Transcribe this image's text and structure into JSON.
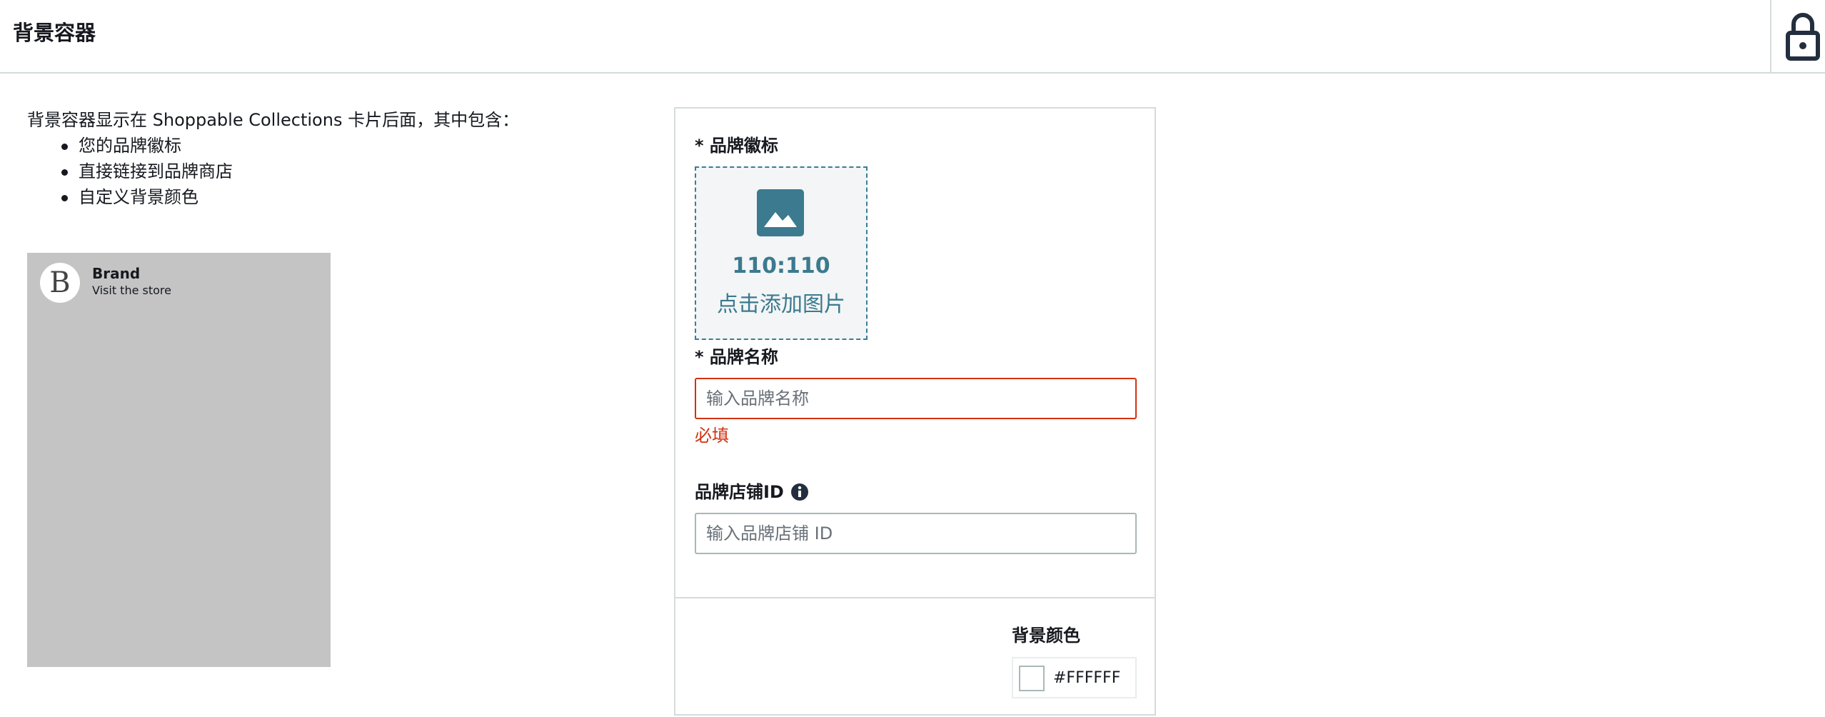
{
  "header": {
    "title": "背景容器",
    "lock_icon": "lock-icon"
  },
  "description": {
    "intro": "背景容器显示在 Shoppable Collections 卡片后面，其中包含：",
    "items": [
      "您的品牌徽标",
      "直接链接到品牌商店",
      "自定义背景颜色"
    ]
  },
  "preview": {
    "logo_letter": "B",
    "brand_name": "Brand",
    "brand_subtitle": "Visit the store",
    "background_color": "#C4C4C4"
  },
  "form": {
    "logo": {
      "label": "* 品牌徽标",
      "ratio": "110:110",
      "action": "点击添加图片",
      "icon": "image-icon"
    },
    "brand_name": {
      "label": "* 品牌名称",
      "placeholder": "输入品牌名称",
      "value": "",
      "error": "必填"
    },
    "store_id": {
      "label": "品牌店铺ID",
      "placeholder": "输入品牌店铺 ID",
      "value": "",
      "info_icon": "info-icon"
    },
    "background_color": {
      "label": "背景颜色",
      "value": "#FFFFFF"
    }
  },
  "colors": {
    "accent": "#3B7A8F",
    "error": "#D13212",
    "border": "#D5DBDB"
  }
}
